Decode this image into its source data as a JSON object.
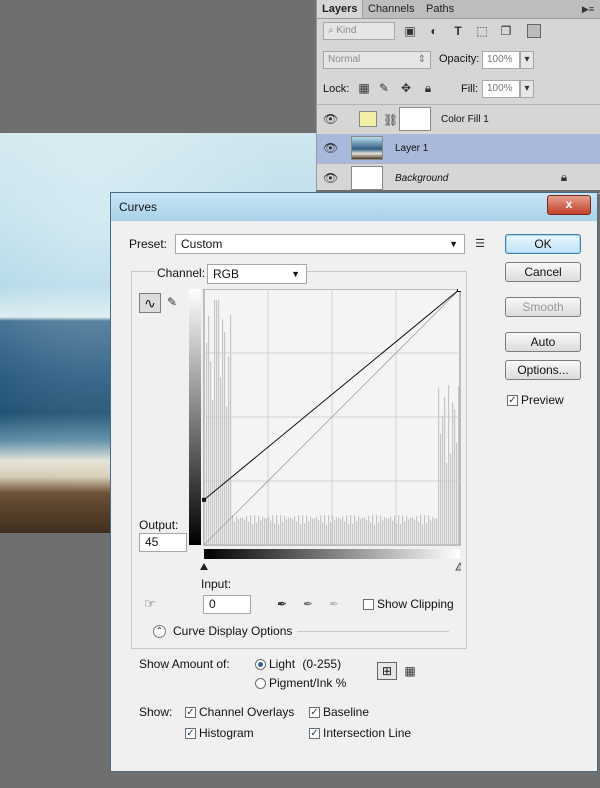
{
  "layers_panel": {
    "tabs": [
      "Layers",
      "Channels",
      "Paths"
    ],
    "kind_placeholder": "Kind",
    "blend_mode": "Normal",
    "opacity_label": "Opacity:",
    "opacity_value": "100%",
    "lock_label": "Lock:",
    "fill_label": "Fill:",
    "fill_value": "100%",
    "layers": [
      {
        "name": "Color Fill 1",
        "selected": false
      },
      {
        "name": "Layer 1",
        "selected": true
      },
      {
        "name": "Background",
        "selected": false,
        "locked": true
      }
    ]
  },
  "dialog": {
    "title": "Curves",
    "close_label": "x",
    "preset_label": "Preset:",
    "preset_value": "Custom",
    "channel_label": "Channel:",
    "channel_value": "RGB",
    "output_label": "Output:",
    "output_value": "45",
    "input_label": "Input:",
    "input_value": "0",
    "show_clipping_label": "Show Clipping",
    "curve_display_label": "Curve Display Options",
    "show_amount_label": "Show Amount of:",
    "light_label": "Light",
    "light_range": "(0-255)",
    "pigment_label": "Pigment/Ink %",
    "show_label": "Show:",
    "channel_overlays_label": "Channel Overlays",
    "baseline_label": "Baseline",
    "histogram_label": "Histogram",
    "intersection_label": "Intersection Line",
    "buttons": {
      "ok": "OK",
      "cancel": "Cancel",
      "smooth": "Smooth",
      "auto": "Auto",
      "options": "Options..."
    },
    "preview_label": "Preview",
    "curve": {
      "input": [
        0,
        255
      ],
      "output": [
        45,
        255
      ]
    },
    "accent": "#3c7fb1"
  }
}
